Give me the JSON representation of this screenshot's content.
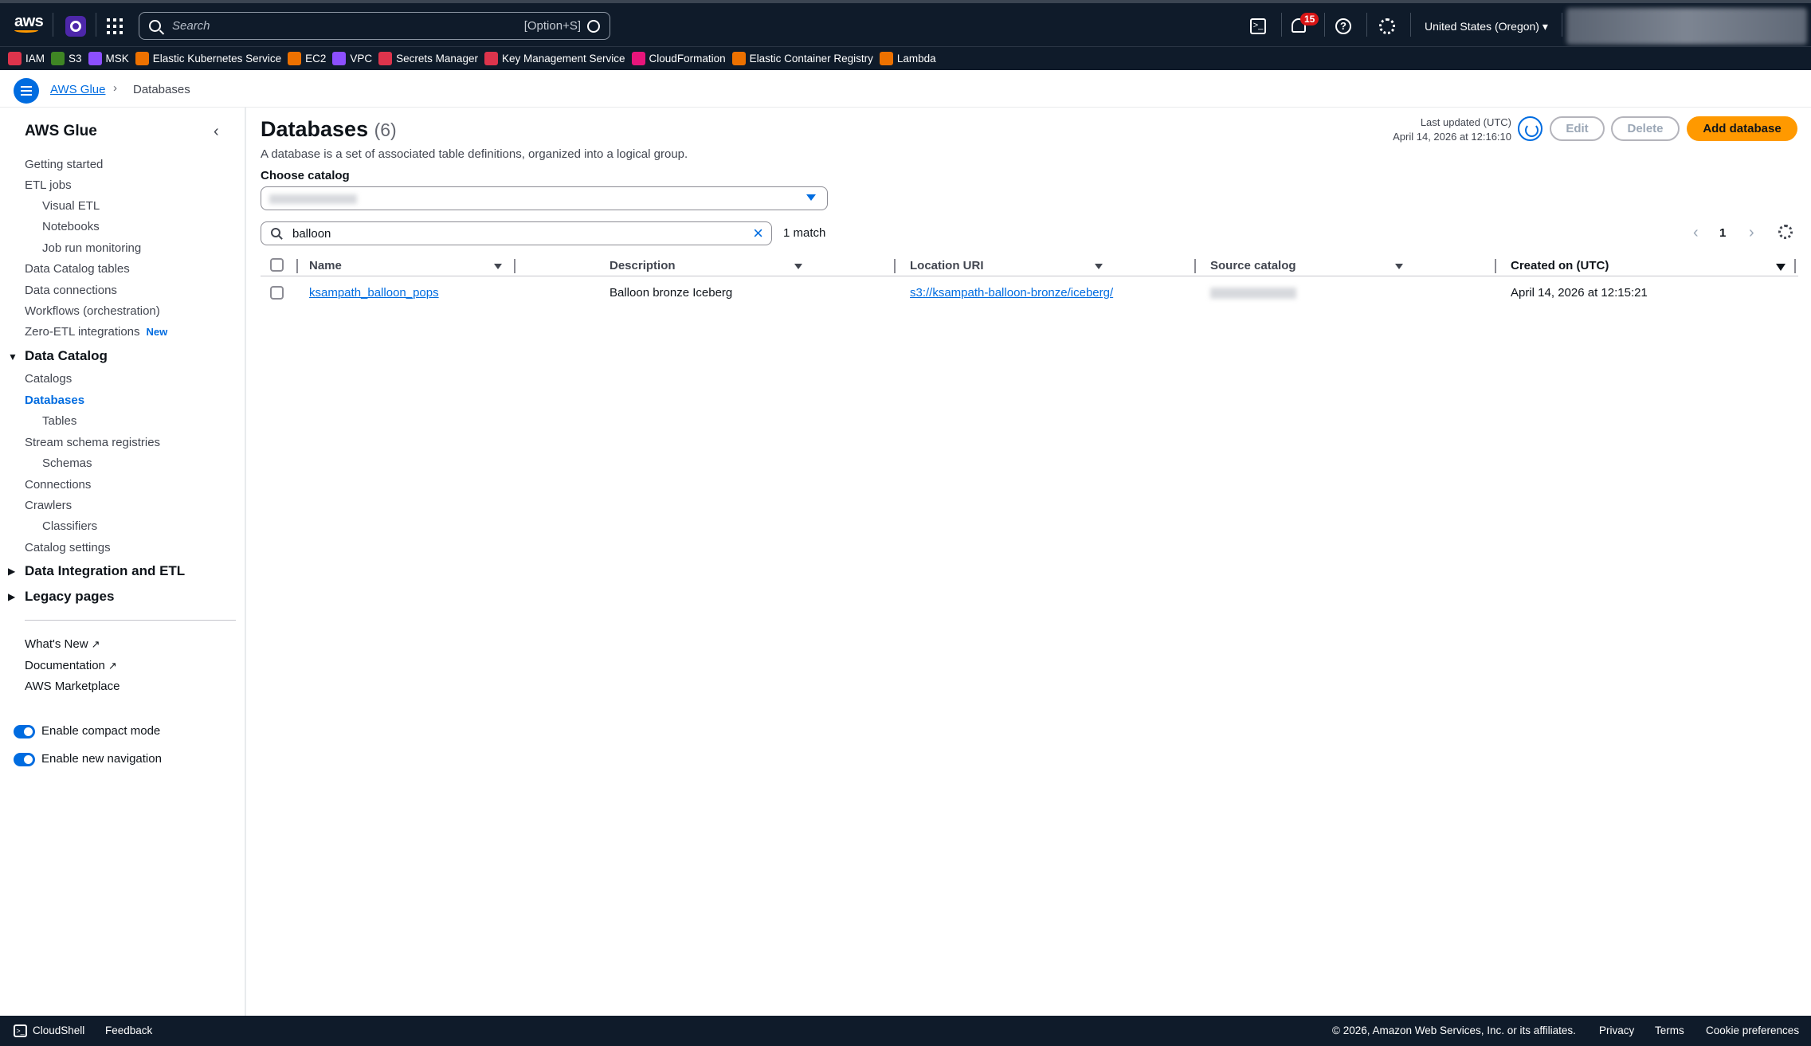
{
  "topbar": {
    "logo": "aws",
    "search_placeholder": "Search",
    "search_shortcut": "[Option+S]",
    "notification_count": "15",
    "region": "United States (Oregon)"
  },
  "favorites": [
    {
      "label": "IAM",
      "color": "#dd344c"
    },
    {
      "label": "S3",
      "color": "#3f8624"
    },
    {
      "label": "MSK",
      "color": "#8c4fff"
    },
    {
      "label": "Elastic Kubernetes Service",
      "color": "#ed7100"
    },
    {
      "label": "EC2",
      "color": "#ed7100"
    },
    {
      "label": "VPC",
      "color": "#8c4fff"
    },
    {
      "label": "Secrets Manager",
      "color": "#dd344c"
    },
    {
      "label": "Key Management Service",
      "color": "#dd344c"
    },
    {
      "label": "CloudFormation",
      "color": "#e7157b"
    },
    {
      "label": "Elastic Container Registry",
      "color": "#ed7100"
    },
    {
      "label": "Lambda",
      "color": "#ed7100"
    }
  ],
  "breadcrumb": {
    "parent": "AWS Glue",
    "current": "Databases"
  },
  "sidebar": {
    "title": "AWS Glue",
    "items": {
      "getting_started": "Getting started",
      "etl_jobs": "ETL jobs",
      "visual_etl": "Visual ETL",
      "notebooks": "Notebooks",
      "job_run_monitoring": "Job run monitoring",
      "data_catalog_tables": "Data Catalog tables",
      "data_connections": "Data connections",
      "workflows": "Workflows (orchestration)",
      "zero_etl": "Zero-ETL integrations",
      "zero_etl_badge": "New",
      "data_catalog": "Data Catalog",
      "catalogs": "Catalogs",
      "databases": "Databases",
      "tables": "Tables",
      "stream_schema_registries": "Stream schema registries",
      "schemas": "Schemas",
      "connections": "Connections",
      "crawlers": "Crawlers",
      "classifiers": "Classifiers",
      "catalog_settings": "Catalog settings",
      "data_integration": "Data Integration and ETL",
      "legacy_pages": "Legacy pages",
      "whats_new": "What's New",
      "documentation": "Documentation",
      "marketplace": "AWS Marketplace"
    },
    "toggles": {
      "compact_mode": "Enable compact mode",
      "new_navigation": "Enable new navigation"
    }
  },
  "main": {
    "title": "Databases",
    "count": "(6)",
    "description": "A database is a set of associated table definitions, organized into a logical group.",
    "last_updated_label": "Last updated (UTC)",
    "last_updated_value": "April 14, 2026 at 12:16:10",
    "buttons": {
      "edit": "Edit",
      "delete": "Delete",
      "add": "Add database"
    },
    "catalog_label": "Choose catalog",
    "filter_value": "balloon",
    "match_text": "1 match",
    "page_number": "1",
    "table": {
      "columns": [
        "Name",
        "Description",
        "Location URI",
        "Source catalog",
        "Created on (UTC)"
      ],
      "rows": [
        {
          "name": "ksampath_balloon_pops",
          "description": "Balloon bronze Iceberg",
          "location": "s3://ksampath-balloon-bronze/iceberg/",
          "created": "April 14, 2026 at 12:15:21"
        }
      ]
    }
  },
  "footer": {
    "cloudshell": "CloudShell",
    "feedback": "Feedback",
    "copyright": "© 2026, Amazon Web Services, Inc. or its affiliates.",
    "privacy": "Privacy",
    "terms": "Terms",
    "cookies": "Cookie preferences"
  }
}
